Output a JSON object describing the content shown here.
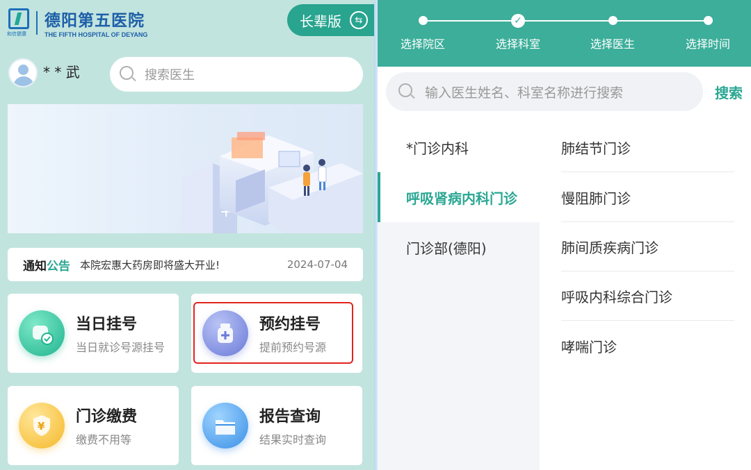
{
  "left": {
    "logo": {
      "title_cn": "德阳第五医院",
      "title_en": "THE FIFTH HOSPITAL OF DEYANG",
      "mark_text": "和信健康"
    },
    "elder_mode": {
      "label": "长辈版",
      "icon": "swap-arrows-icon"
    },
    "user": {
      "name": "* * 武",
      "icon": "avatar-icon"
    },
    "search": {
      "placeholder": "搜索医生",
      "icon": "search-icon"
    },
    "notice": {
      "label_a": "通知",
      "label_b": "公告",
      "message": "本院宏惠大药房即将盛大开业!",
      "date": "2024-07-04"
    },
    "cards": [
      {
        "title": "当日挂号",
        "subtitle": "当日就诊号源挂号",
        "icon": "clock-check-icon",
        "color": "#1fb48f"
      },
      {
        "title": "预约挂号",
        "subtitle": "提前预约号源",
        "icon": "medicine-bottle-icon",
        "color": "#6a7ad8"
      },
      {
        "title": "门诊缴费",
        "subtitle": "缴费不用等",
        "icon": "yuan-shield-icon",
        "glyph": "¥",
        "color": "#f5b829"
      },
      {
        "title": "报告查询",
        "subtitle": "结果实时查询",
        "icon": "folder-icon",
        "color": "#3a8fe6"
      }
    ],
    "highlight_color": "#e3231c"
  },
  "right": {
    "steps": [
      {
        "label": "选择院区",
        "state": "done"
      },
      {
        "label": "选择科室",
        "state": "current"
      },
      {
        "label": "选择医生",
        "state": "todo"
      },
      {
        "label": "选择时间",
        "state": "todo"
      }
    ],
    "search": {
      "placeholder": "输入医生姓名、科室名称进行搜索",
      "button": "搜索"
    },
    "departments": [
      {
        "name": "*门诊内科",
        "active": false
      },
      {
        "name": "呼吸肾病内科门诊",
        "active": true
      },
      {
        "name": "门诊部(德阳)",
        "active": false
      }
    ],
    "clinics": [
      "肺结节门诊",
      "慢阻肺门诊",
      "肺间质疾病门诊",
      "呼吸内科综合门诊",
      "哮喘门诊"
    ],
    "accent_color": "#3cae9a"
  }
}
